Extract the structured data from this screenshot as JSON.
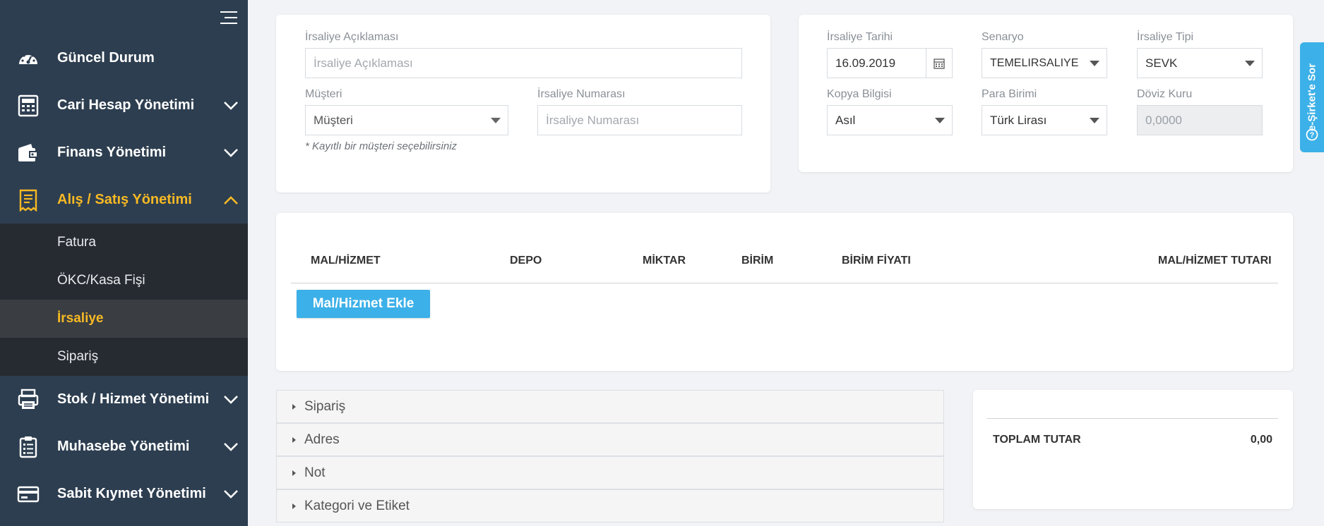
{
  "sidebar": {
    "items": [
      {
        "label": "Güncel Durum",
        "icon": "dashboard-gauge-icon",
        "expanded": null
      },
      {
        "label": "Cari Hesap Yönetimi",
        "icon": "calculator-icon",
        "expanded": false
      },
      {
        "label": "Finans Yönetimi",
        "icon": "wallet-icon",
        "expanded": false
      },
      {
        "label": "Alış / Satış Yönetimi",
        "icon": "receipt-icon",
        "expanded": true
      },
      {
        "label": "Stok / Hizmet Yönetimi",
        "icon": "printer-box-icon",
        "expanded": false
      },
      {
        "label": "Muhasebe Yönetimi",
        "icon": "clipboard-list-icon",
        "expanded": false
      },
      {
        "label": "Sabit Kıymet Yönetimi",
        "icon": "credit-card-icon",
        "expanded": false
      }
    ],
    "submenu": [
      {
        "label": "Fatura"
      },
      {
        "label": "ÖKC/Kasa Fişi"
      },
      {
        "label": "İrsaliye",
        "active": true
      },
      {
        "label": "Sipariş"
      }
    ]
  },
  "form": {
    "aciklama_label": "İrsaliye Açıklaması",
    "aciklama_placeholder": "İrsaliye Açıklaması",
    "musteri_label": "Müşteri",
    "musteri_value": "Müşteri",
    "numara_label": "İrsaliye Numarası",
    "numara_placeholder": "İrsaliye Numarası",
    "hint": "* Kayıtlı bir müşteri seçebilirsiniz",
    "tarih_label": "İrsaliye Tarihi",
    "tarih_value": "16.09.2019",
    "senaryo_label": "Senaryo",
    "senaryo_value": "TEMELIRSALIYE",
    "tip_label": "İrsaliye Tipi",
    "tip_value": "SEVK",
    "kopya_label": "Kopya Bilgisi",
    "kopya_value": "Asıl",
    "para_label": "Para Birimi",
    "para_value": "Türk Lirası",
    "doviz_label": "Döviz Kuru",
    "doviz_value": "0,0000"
  },
  "table": {
    "headers": [
      "MAL/HİZMET",
      "DEPO",
      "MİKTAR",
      "BİRİM",
      "BİRİM FİYATI",
      "MAL/HİZMET TUTARI"
    ],
    "add_button": "Mal/Hizmet Ekle"
  },
  "accordion": [
    "Sipariş",
    "Adres",
    "Not",
    "Kategori ve Etiket"
  ],
  "totals": {
    "label": "TOPLAM TUTAR",
    "value": "0,00"
  },
  "side_tab": "e-Şirket'e Sor",
  "colors": {
    "sidebar_bg": "#2d3e50",
    "submenu_bg": "#262b31",
    "accent": "#f7b924",
    "button": "#3cb0e8"
  }
}
